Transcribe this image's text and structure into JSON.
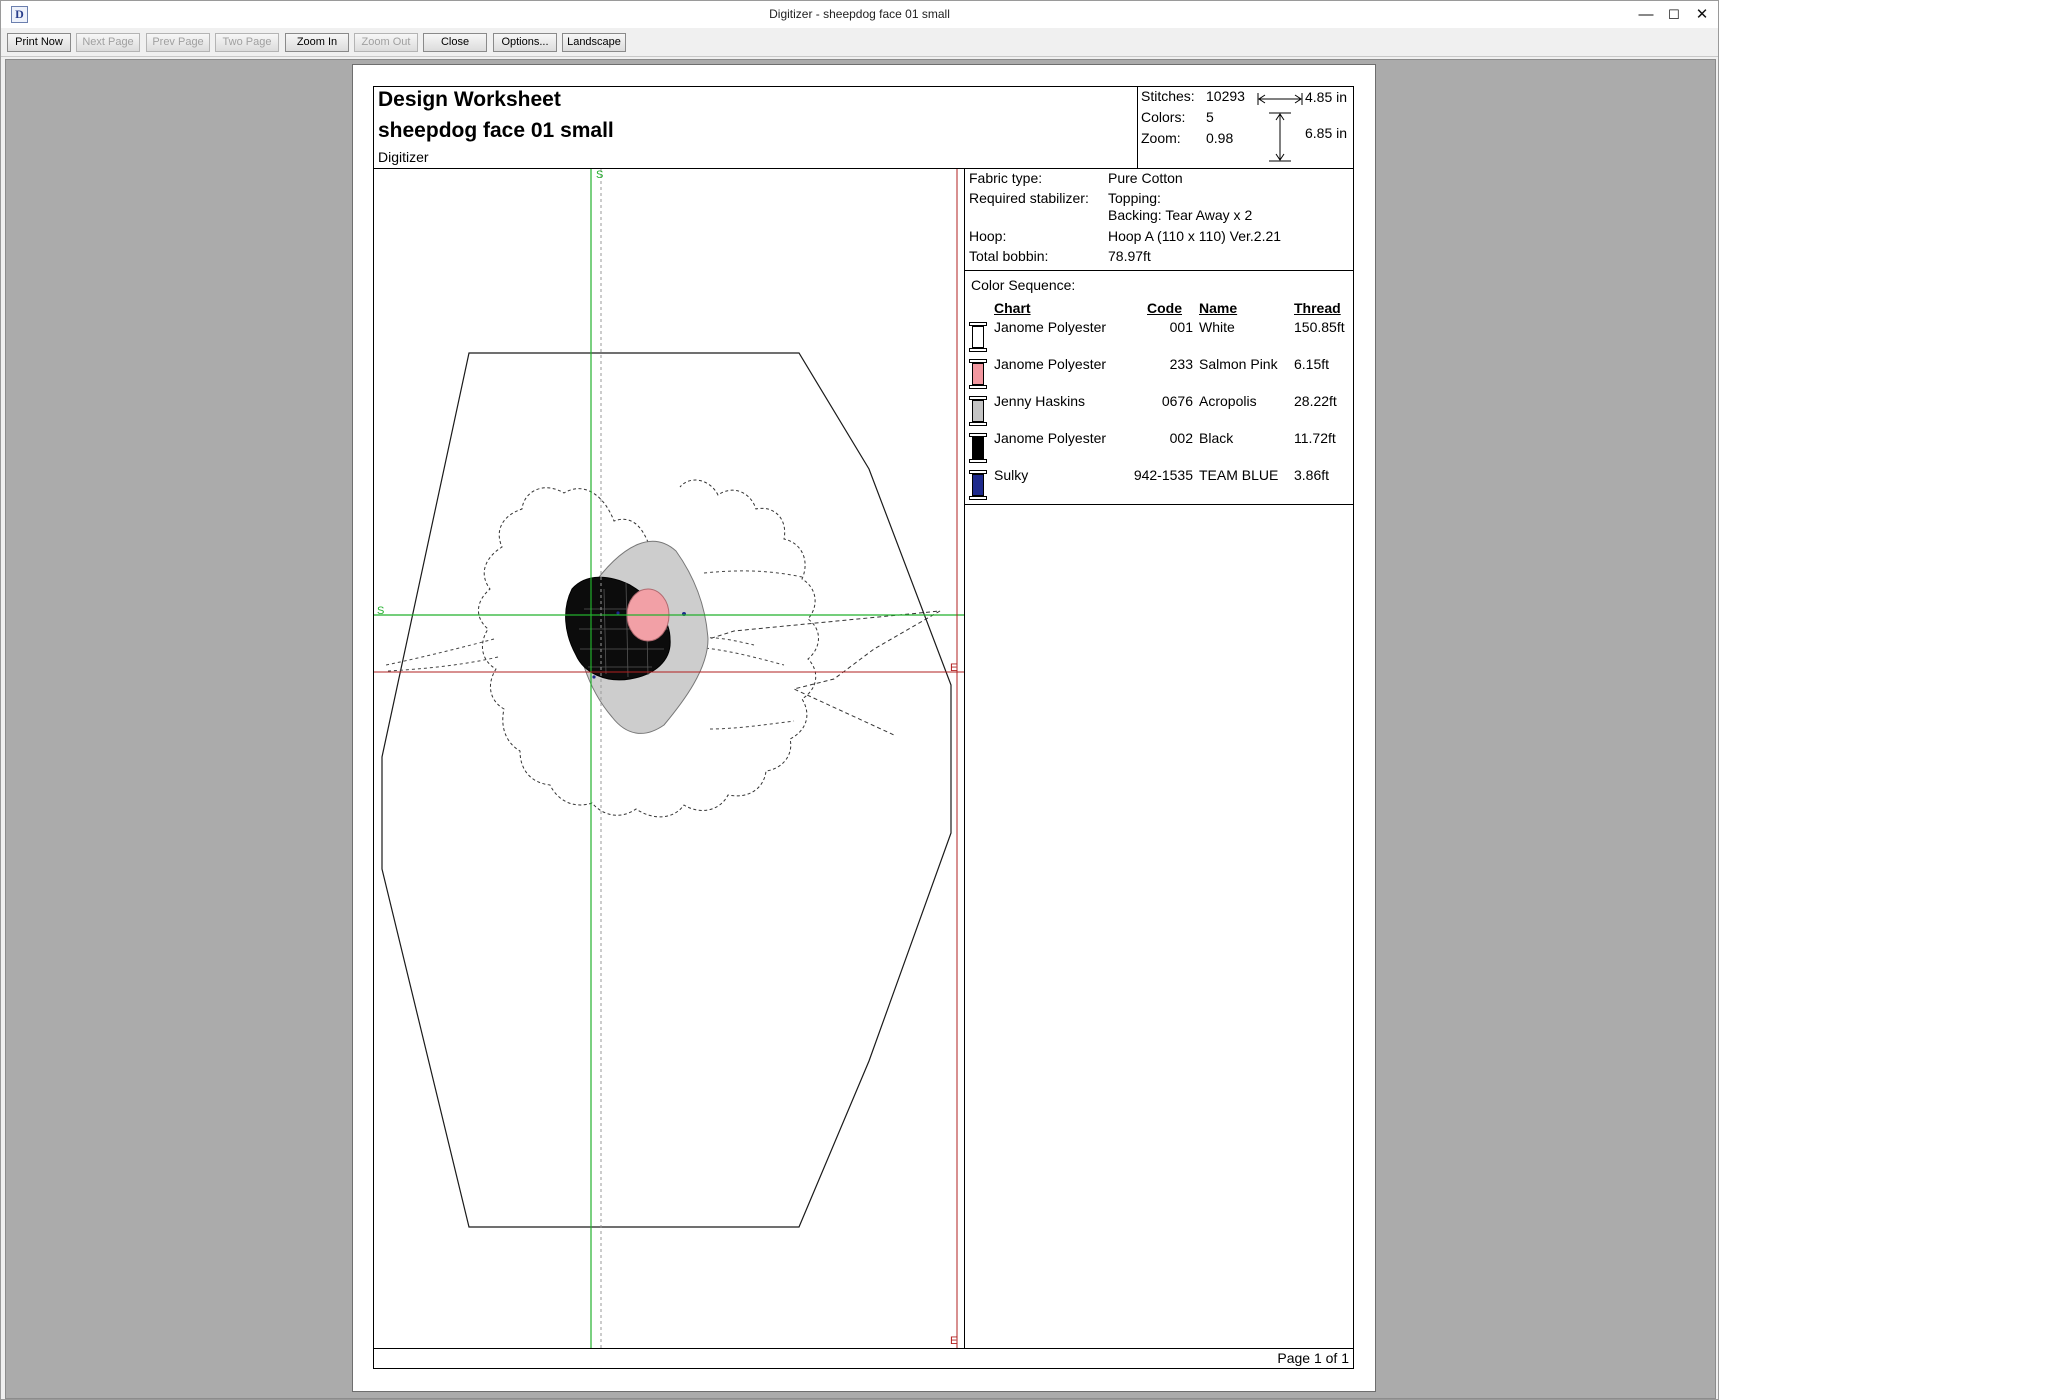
{
  "window": {
    "title": "Digitizer - sheepdog face 01 small",
    "icon": "app-icon",
    "icon_glyph": "D",
    "controls": {
      "minimize": "—",
      "maximize": "☐",
      "close": "✕"
    }
  },
  "toolbar": {
    "buttons": [
      {
        "label": "Print Now",
        "enabled": true
      },
      {
        "label": "Next Page",
        "enabled": false
      },
      {
        "label": "Prev Page",
        "enabled": false
      },
      {
        "label": "Two Page",
        "enabled": false
      },
      {
        "label": "Zoom In",
        "enabled": true
      },
      {
        "label": "Zoom Out",
        "enabled": false
      },
      {
        "label": "Close",
        "enabled": true
      },
      {
        "label": "Options...",
        "enabled": true
      },
      {
        "label": "Landscape",
        "enabled": true
      }
    ]
  },
  "worksheet": {
    "title": "Design Worksheet",
    "design_name": "sheepdog face 01 small",
    "app_name": "Digitizer",
    "stats": {
      "stitches_label": "Stitches:",
      "stitches": "10293",
      "colors_label": "Colors:",
      "colors": "5",
      "zoom_label": "Zoom:",
      "zoom": "0.98",
      "width": "4.85 in",
      "height": "6.85 in"
    },
    "properties": {
      "fabric_label": "Fabric type:",
      "fabric": "Pure Cotton",
      "stabilizer_label": "Required stabilizer:",
      "topping": "Topping:",
      "backing": "Backing: Tear Away x 2",
      "hoop_label": "Hoop:",
      "hoop": "Hoop A (110 x 110) Ver.2.21",
      "bobbin_label": "Total bobbin:",
      "bobbin": "78.97ft"
    },
    "color_sequence": {
      "title": "Color Sequence:",
      "headers": {
        "chart": "Chart",
        "code": "Code",
        "name": "Name",
        "thread": "Thread"
      },
      "rows": [
        {
          "chart": "Janome Polyester",
          "code": "001",
          "name": "White",
          "thread": "150.85ft",
          "color": "#ffffff"
        },
        {
          "chart": "Janome Polyester",
          "code": "233",
          "name": "Salmon Pink",
          "thread": "6.15ft",
          "color": "#f2979f"
        },
        {
          "chart": "Jenny Haskins",
          "code": "0676",
          "name": "Acropolis",
          "thread": "28.22ft",
          "color": "#c4c4c4"
        },
        {
          "chart": "Janome Polyester",
          "code": "002",
          "name": "Black",
          "thread": "11.72ft",
          "color": "#000000"
        },
        {
          "chart": "Sulky",
          "code": "942-1535",
          "name": "TEAM BLUE",
          "thread": "3.86ft",
          "color": "#1e2a8c"
        }
      ]
    },
    "canvas_markers": {
      "start": "S",
      "end": "E"
    },
    "page": "Page 1 of 1"
  }
}
